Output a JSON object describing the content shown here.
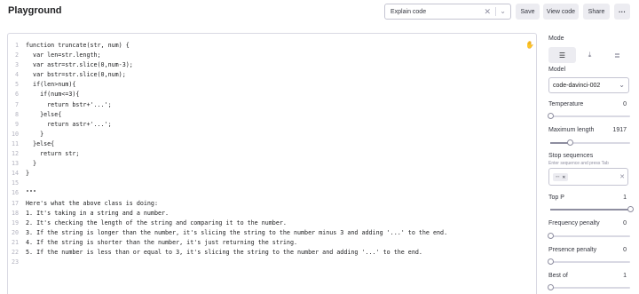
{
  "header": {
    "title": "Playground",
    "preset_value": "Explain code",
    "save_label": "Save",
    "view_code_label": "View code",
    "share_label": "Share",
    "more_label": "···"
  },
  "editor": {
    "lines": [
      "function truncate(str, num) {",
      "  var len=str.length;",
      "  var astr=str.slice(0,num-3);",
      "  var bstr=str.slice(0,num);",
      "  if(len>num){",
      "    if(num<=3){",
      "      return bstr+'...';",
      "    }else{",
      "      return astr+'...';",
      "    }",
      "  }else{",
      "    return str;",
      "  }",
      "}",
      "",
      "\"\"\"",
      "Here's what the above class is doing:",
      "1. It's taking in a string and a number.",
      "2. It's checking the length of the string and comparing it to the number.",
      "3. If the string is longer than the number, it's slicing the string to the number minus 3 and adding '...' to the end.",
      "4. If the string is shorter than the number, it's just returning the string.",
      "5. If the number is less than or equal to 3, it's slicing the string to the number and adding '...' to the end.",
      ""
    ],
    "line_numbers": [
      "1",
      "2",
      "3",
      "4",
      "5",
      "6",
      "7",
      "8",
      "9",
      "10",
      "11",
      "12",
      "13",
      "14",
      "15",
      "16",
      "17",
      "18",
      "19",
      "20",
      "21",
      "22",
      "23"
    ]
  },
  "sidebar": {
    "mode_label": "Mode",
    "mode_options": [
      "complete-icon",
      "insert-icon",
      "edit-icon"
    ],
    "model_label": "Model",
    "model_value": "code-davinci-002",
    "temperature_label": "Temperature",
    "temperature_value": "0",
    "temperature_fraction": 0,
    "max_length_label": "Maximum length",
    "max_length_value": "1917",
    "max_length_fraction": 0.24,
    "stop_label": "Stop sequences",
    "stop_hint": "Enter sequence and press Tab",
    "stop_chip": "\"\"\"",
    "top_p_label": "Top P",
    "top_p_value": "1",
    "top_p_fraction": 1,
    "freq_label": "Frequency penalty",
    "freq_value": "0",
    "freq_fraction": 0,
    "presence_label": "Presence penalty",
    "presence_value": "0",
    "presence_fraction": 0,
    "best_of_label": "Best of",
    "best_of_value": "1",
    "best_of_fraction": 0
  },
  "colors": {
    "accent": "#10a37f",
    "border": "#d9d9e3",
    "button_bg": "#ececf1"
  }
}
